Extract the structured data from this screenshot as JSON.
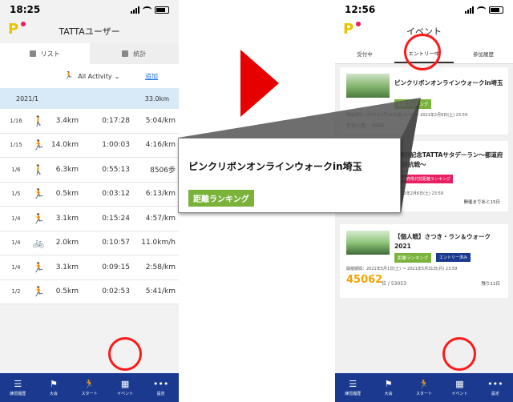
{
  "left_screen": {
    "status": {
      "time": "18:25"
    },
    "title": "TATTAユーザー",
    "tabs": [
      {
        "label": "リスト",
        "active": true
      },
      {
        "label": "統計",
        "active": false
      }
    ],
    "filter_label": "All Activity",
    "add_label": "追加",
    "month": {
      "label": "2021/1",
      "total": "33.0km"
    },
    "activities": [
      {
        "date": "1/16",
        "icon": "walking-icon",
        "distance": "3.4km",
        "time": "0:17:28",
        "pace": "5:04/km"
      },
      {
        "date": "1/15",
        "icon": "running-icon",
        "distance": "14.0km",
        "time": "1:00:03",
        "pace": "4:16/km"
      },
      {
        "date": "1/6",
        "icon": "walking-icon",
        "distance": "6.3km",
        "time": "0:55:13",
        "pace": "8506歩"
      },
      {
        "date": "1/5",
        "icon": "running-icon",
        "distance": "0.5km",
        "time": "0:03:12",
        "pace": "6:13/km"
      },
      {
        "date": "1/4",
        "icon": "running-icon",
        "distance": "3.1km",
        "time": "0:15:24",
        "pace": "4:57/km"
      },
      {
        "date": "1/4",
        "icon": "bicycle-icon",
        "distance": "2.0km",
        "time": "0:10:57",
        "pace": "11.0km/h"
      },
      {
        "date": "1/4",
        "icon": "running-icon",
        "distance": "3.1km",
        "time": "0:09:15",
        "pace": "2:58/km"
      },
      {
        "date": "1/2",
        "icon": "running-icon",
        "distance": "0.5km",
        "time": "0:02:53",
        "pace": "5:41/km"
      }
    ],
    "nav": [
      "練習履歴",
      "大会",
      "スタート",
      "イベント",
      "設定"
    ]
  },
  "right_screen": {
    "status": {
      "time": "12:56"
    },
    "title": "イベント",
    "tabs": [
      {
        "label": "受付中",
        "active": false
      },
      {
        "label": "エントリー中",
        "active": true
      },
      {
        "label": "参加履歴",
        "active": false
      }
    ],
    "card1": {
      "name": "ピンクリボンオンラインウォークin埼玉",
      "badge": "距離ランキング",
      "period": "開催期間：2021年1月22日(金) 6:00 ～ 2021年2月6日(土) 23:59",
      "participants": "参加人数： 2966"
    },
    "card2": {
      "title": "50回記念TATTAサタデーラン～都道府県対抗戦～",
      "tag": "都道府県対抗距離ランキング",
      "period": "2021年2月6日(土) 23:59",
      "remaining": "開催まであと15日"
    },
    "card3": {
      "title": "【個人戦】さつき・ラン＆ウォーク2021",
      "badge1": "距離ランキング",
      "badge2": "エントリー済み",
      "period": "開催期間：2021年5月1日(土) ～ 2021年5月31日(月) 23:59",
      "rank": "45062",
      "rank_sub": "位 / 53053",
      "remaining": "残り11日"
    },
    "nav": [
      "練習履歴",
      "大会",
      "スタート",
      "イベント",
      "設定"
    ]
  },
  "callout": {
    "title": "ピンクリボンオンラインウォークin埼玉",
    "badge": "距離ランキング"
  },
  "colors": {
    "nav": "#1b3a8f",
    "highlight": "#ff1a1a",
    "badge_green": "#7ab23a",
    "arrow": "#e60000"
  }
}
